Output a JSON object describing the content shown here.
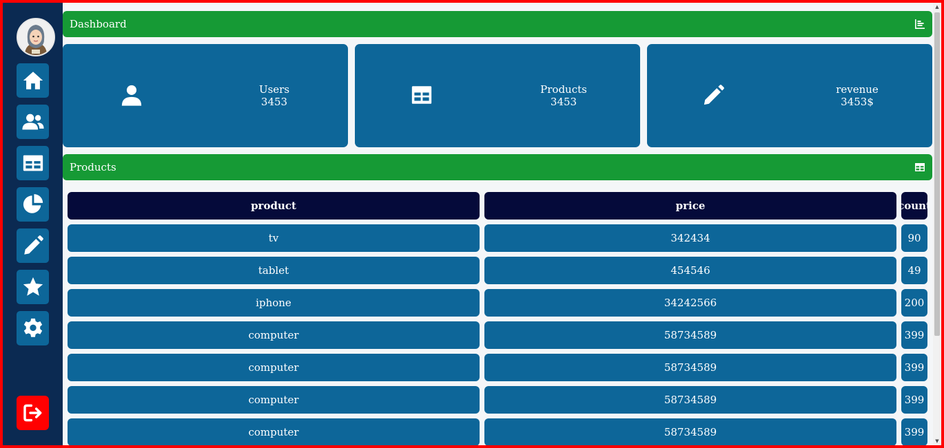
{
  "sidebar": {
    "nav": [
      "home-icon",
      "users-icon",
      "table-icon",
      "pie-chart-icon",
      "pencil-icon",
      "star-icon",
      "gear-icon"
    ],
    "logout_icon": "logout-icon"
  },
  "dashboard_header": {
    "title": "Dashboard",
    "icon": "bar-chart-icon"
  },
  "stats": [
    {
      "label": "Users",
      "value": "3453",
      "icon": "user-icon"
    },
    {
      "label": "Products",
      "value": "3453",
      "icon": "table-icon"
    },
    {
      "label": "revenue",
      "value": "3453$",
      "icon": "pencil-icon"
    }
  ],
  "products_header": {
    "title": "Products",
    "icon": "table-icon"
  },
  "table": {
    "columns": [
      "product",
      "price",
      "count"
    ],
    "rows": [
      [
        "tv",
        "342434",
        "90"
      ],
      [
        "tablet",
        "454546",
        "49"
      ],
      [
        "iphone",
        "34242566",
        "200"
      ],
      [
        "computer",
        "58734589",
        "399"
      ],
      [
        "computer",
        "58734589",
        "399"
      ],
      [
        "computer",
        "58734589",
        "399"
      ],
      [
        "computer",
        "58734589",
        "399"
      ]
    ]
  },
  "colors": {
    "sidebar_bg": "#0b2a52",
    "accent_green": "#169a35",
    "card_blue": "#0d6699",
    "table_header": "#050a3a",
    "logout_red": "#ff0000"
  }
}
